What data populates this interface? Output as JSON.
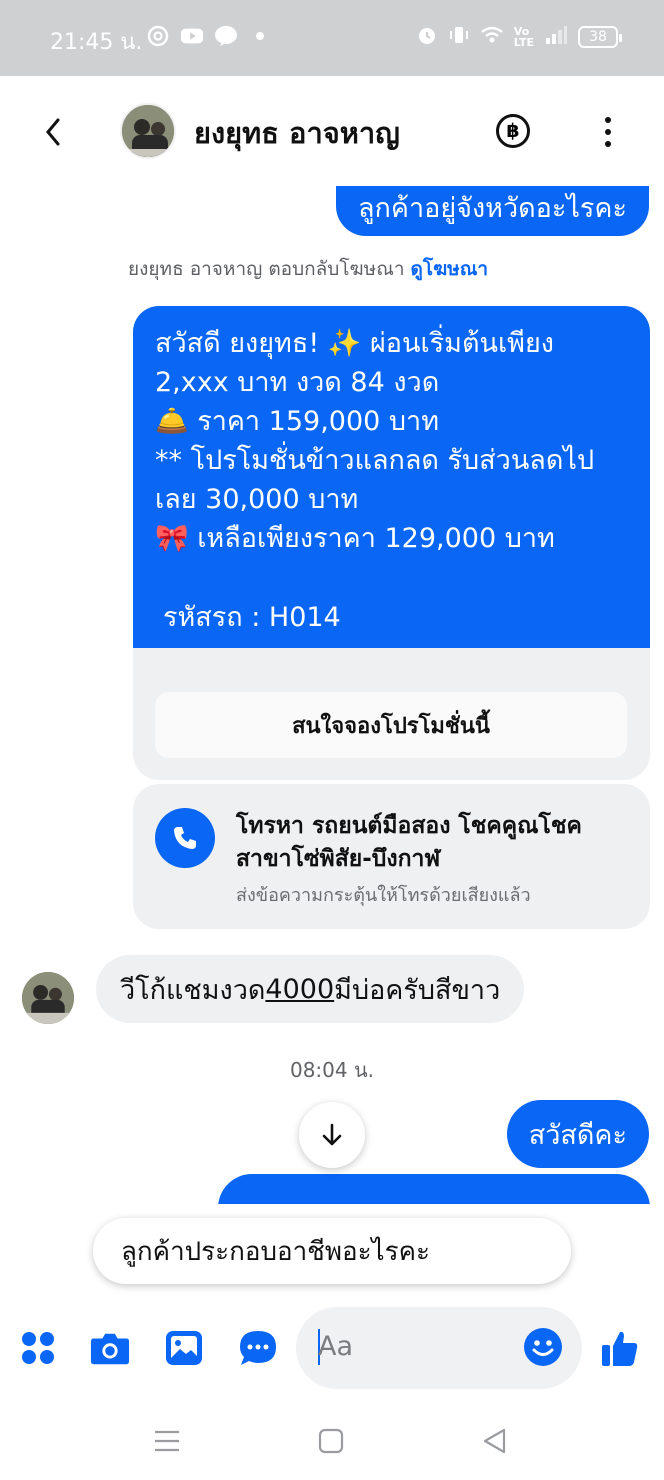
{
  "status_bar": {
    "time": "21:45 น.",
    "battery": "38"
  },
  "header": {
    "contact_name": "ยงยุทธ อาจหาญ",
    "baht_symbol": "฿"
  },
  "messages": {
    "outgoing_1": "ลูกค้าอยู่จังหวัดอะไรคะ",
    "reply_note_prefix": "ยงยุทธ อาจหาญ ตอบกลับโฆษณา",
    "reply_note_link": "ดูโฆษณา",
    "ad_lines": [
      "สวัสดี ยงยุทธ! ✨  ผ่อนเริ่มต้นเพียง",
      "2,xxx บาท งวด 84 งวด",
      "🛎️ ราคา 159,000 บาท",
      "** โปรโมชั่นข้าวแลกลด รับส่วนลดไป",
      "เลย 30,000 บาท",
      "🎀  เหลือเพียงราคา 129,000 บาท"
    ],
    "ad_code": "รหัสรถ : H014",
    "promo_button": "สนใจจองโปรโมชั่นนี้",
    "call_title": "โทรหา รถยนต์มือสอง โชคคูณโชค สาขาโซ่พิสัย-บึงกาฬ",
    "call_subtitle": "ส่งข้อความกระตุ้นให้โทรด้วยเสียงแล้ว",
    "incoming_prefix": "วีโก้แชมงวด",
    "incoming_number": "4000",
    "incoming_suffix": "มีบ่อครับสีขาว",
    "timestamp": "08:04 น.",
    "outgoing_2": "สวัสดีคะ"
  },
  "suggestion": "ลูกค้าประกอบอาชีพอะไรคะ",
  "composer": {
    "placeholder": "Aa"
  },
  "colors": {
    "accent": "#0a66f5",
    "bubble_gray": "#eff0f2",
    "status_bar": "#cfd0d2"
  }
}
